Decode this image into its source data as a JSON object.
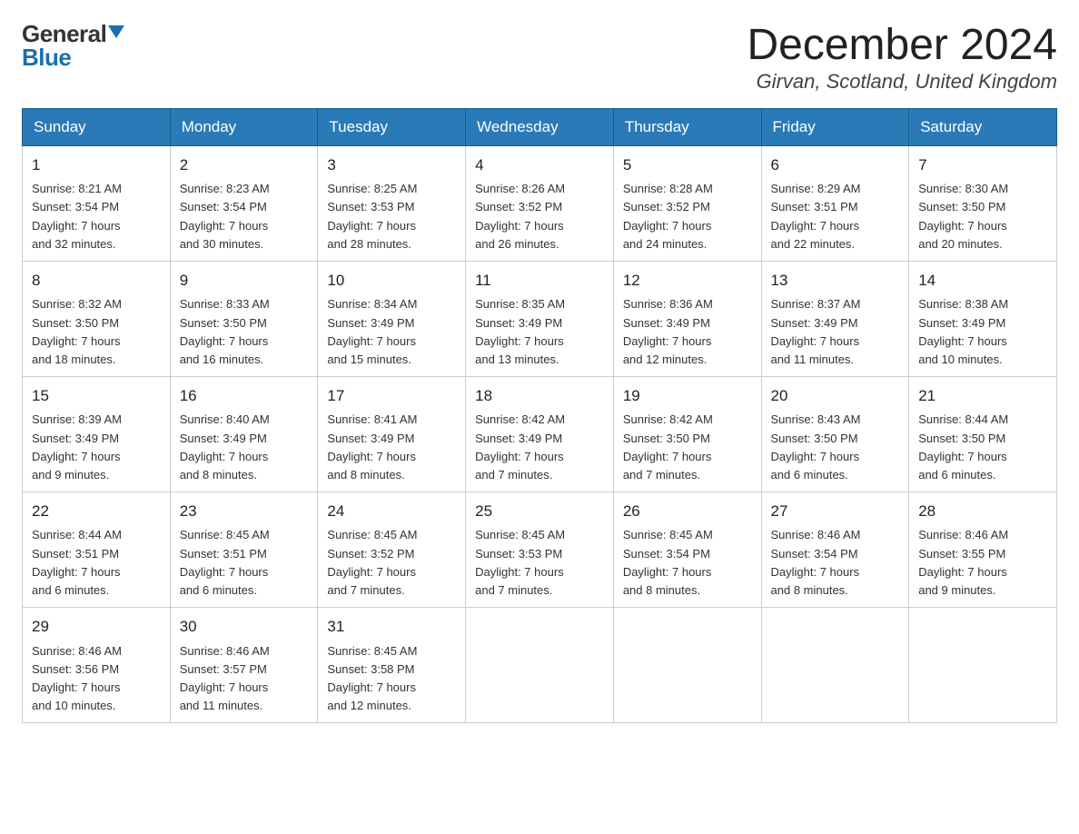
{
  "header": {
    "logo_general": "General",
    "logo_blue": "Blue",
    "main_title": "December 2024",
    "subtitle": "Girvan, Scotland, United Kingdom"
  },
  "weekdays": [
    "Sunday",
    "Monday",
    "Tuesday",
    "Wednesday",
    "Thursday",
    "Friday",
    "Saturday"
  ],
  "weeks": [
    [
      {
        "day": "1",
        "info": "Sunrise: 8:21 AM\nSunset: 3:54 PM\nDaylight: 7 hours\nand 32 minutes."
      },
      {
        "day": "2",
        "info": "Sunrise: 8:23 AM\nSunset: 3:54 PM\nDaylight: 7 hours\nand 30 minutes."
      },
      {
        "day": "3",
        "info": "Sunrise: 8:25 AM\nSunset: 3:53 PM\nDaylight: 7 hours\nand 28 minutes."
      },
      {
        "day": "4",
        "info": "Sunrise: 8:26 AM\nSunset: 3:52 PM\nDaylight: 7 hours\nand 26 minutes."
      },
      {
        "day": "5",
        "info": "Sunrise: 8:28 AM\nSunset: 3:52 PM\nDaylight: 7 hours\nand 24 minutes."
      },
      {
        "day": "6",
        "info": "Sunrise: 8:29 AM\nSunset: 3:51 PM\nDaylight: 7 hours\nand 22 minutes."
      },
      {
        "day": "7",
        "info": "Sunrise: 8:30 AM\nSunset: 3:50 PM\nDaylight: 7 hours\nand 20 minutes."
      }
    ],
    [
      {
        "day": "8",
        "info": "Sunrise: 8:32 AM\nSunset: 3:50 PM\nDaylight: 7 hours\nand 18 minutes."
      },
      {
        "day": "9",
        "info": "Sunrise: 8:33 AM\nSunset: 3:50 PM\nDaylight: 7 hours\nand 16 minutes."
      },
      {
        "day": "10",
        "info": "Sunrise: 8:34 AM\nSunset: 3:49 PM\nDaylight: 7 hours\nand 15 minutes."
      },
      {
        "day": "11",
        "info": "Sunrise: 8:35 AM\nSunset: 3:49 PM\nDaylight: 7 hours\nand 13 minutes."
      },
      {
        "day": "12",
        "info": "Sunrise: 8:36 AM\nSunset: 3:49 PM\nDaylight: 7 hours\nand 12 minutes."
      },
      {
        "day": "13",
        "info": "Sunrise: 8:37 AM\nSunset: 3:49 PM\nDaylight: 7 hours\nand 11 minutes."
      },
      {
        "day": "14",
        "info": "Sunrise: 8:38 AM\nSunset: 3:49 PM\nDaylight: 7 hours\nand 10 minutes."
      }
    ],
    [
      {
        "day": "15",
        "info": "Sunrise: 8:39 AM\nSunset: 3:49 PM\nDaylight: 7 hours\nand 9 minutes."
      },
      {
        "day": "16",
        "info": "Sunrise: 8:40 AM\nSunset: 3:49 PM\nDaylight: 7 hours\nand 8 minutes."
      },
      {
        "day": "17",
        "info": "Sunrise: 8:41 AM\nSunset: 3:49 PM\nDaylight: 7 hours\nand 8 minutes."
      },
      {
        "day": "18",
        "info": "Sunrise: 8:42 AM\nSunset: 3:49 PM\nDaylight: 7 hours\nand 7 minutes."
      },
      {
        "day": "19",
        "info": "Sunrise: 8:42 AM\nSunset: 3:50 PM\nDaylight: 7 hours\nand 7 minutes."
      },
      {
        "day": "20",
        "info": "Sunrise: 8:43 AM\nSunset: 3:50 PM\nDaylight: 7 hours\nand 6 minutes."
      },
      {
        "day": "21",
        "info": "Sunrise: 8:44 AM\nSunset: 3:50 PM\nDaylight: 7 hours\nand 6 minutes."
      }
    ],
    [
      {
        "day": "22",
        "info": "Sunrise: 8:44 AM\nSunset: 3:51 PM\nDaylight: 7 hours\nand 6 minutes."
      },
      {
        "day": "23",
        "info": "Sunrise: 8:45 AM\nSunset: 3:51 PM\nDaylight: 7 hours\nand 6 minutes."
      },
      {
        "day": "24",
        "info": "Sunrise: 8:45 AM\nSunset: 3:52 PM\nDaylight: 7 hours\nand 7 minutes."
      },
      {
        "day": "25",
        "info": "Sunrise: 8:45 AM\nSunset: 3:53 PM\nDaylight: 7 hours\nand 7 minutes."
      },
      {
        "day": "26",
        "info": "Sunrise: 8:45 AM\nSunset: 3:54 PM\nDaylight: 7 hours\nand 8 minutes."
      },
      {
        "day": "27",
        "info": "Sunrise: 8:46 AM\nSunset: 3:54 PM\nDaylight: 7 hours\nand 8 minutes."
      },
      {
        "day": "28",
        "info": "Sunrise: 8:46 AM\nSunset: 3:55 PM\nDaylight: 7 hours\nand 9 minutes."
      }
    ],
    [
      {
        "day": "29",
        "info": "Sunrise: 8:46 AM\nSunset: 3:56 PM\nDaylight: 7 hours\nand 10 minutes."
      },
      {
        "day": "30",
        "info": "Sunrise: 8:46 AM\nSunset: 3:57 PM\nDaylight: 7 hours\nand 11 minutes."
      },
      {
        "day": "31",
        "info": "Sunrise: 8:45 AM\nSunset: 3:58 PM\nDaylight: 7 hours\nand 12 minutes."
      },
      {
        "day": "",
        "info": ""
      },
      {
        "day": "",
        "info": ""
      },
      {
        "day": "",
        "info": ""
      },
      {
        "day": "",
        "info": ""
      }
    ]
  ]
}
